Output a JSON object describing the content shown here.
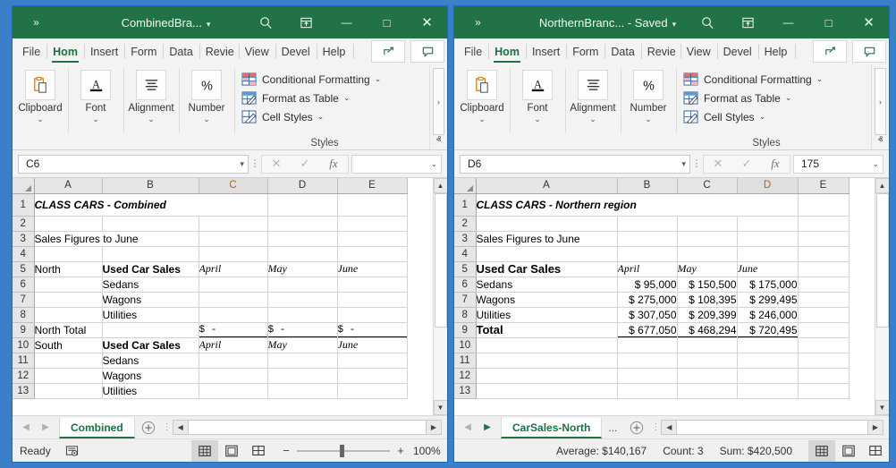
{
  "windows": [
    {
      "id": "left",
      "titlebar": {
        "qat_label": "»",
        "title": "CombinedBra...",
        "caret": "▾",
        "search_icon": "search-icon",
        "restore_icon": "ribbon-display-options-icon",
        "minimize_label": "—",
        "maximize_label": "□",
        "close_label": "✕"
      },
      "ribbon_tabs": {
        "items": [
          "File",
          "Hom",
          "Insert",
          "Form",
          "Data",
          "Revie",
          "View",
          "Devel",
          "Help"
        ],
        "active_index": 1,
        "share_icon": "share-icon",
        "comments_icon": "comment-icon"
      },
      "ribbon": {
        "groups": [
          {
            "label": "Clipboard",
            "icon": "clipboard-icon",
            "caret": "⌄"
          },
          {
            "label": "Font",
            "icon": "font-icon",
            "caret": "⌄"
          },
          {
            "label": "Alignment",
            "icon": "alignment-icon",
            "caret": "⌄"
          },
          {
            "label": "Number",
            "icon": "percent-icon",
            "caret": "⌄"
          }
        ],
        "styles": {
          "group_name": "Styles",
          "items": [
            {
              "label": "Conditional Formatting",
              "icon": "conditional-formatting-icon",
              "caret": "⌄"
            },
            {
              "label": "Format as Table",
              "icon": "format-as-table-icon",
              "caret": "⌄"
            },
            {
              "label": "Cell Styles",
              "icon": "cell-styles-icon",
              "caret": "⌄"
            }
          ]
        },
        "more_label": "›",
        "collapse_label": "ⱏ"
      },
      "formula_bar": {
        "name_box": "C6",
        "name_caret": "▾",
        "cancel_label": "✕",
        "enter_label": "✓",
        "fx_label": "fx",
        "formula_value": "",
        "expand_caret": "⌄"
      },
      "grid": {
        "columns": [
          "A",
          "B",
          "C",
          "D",
          "E"
        ],
        "selected_column": "C",
        "rows": [
          "1",
          "2",
          "3",
          "4",
          "5",
          "6",
          "7",
          "8",
          "9",
          "10",
          "11",
          "12",
          "13"
        ],
        "selected_row": "6",
        "cells": {
          "r1": {
            "A": "CLASS CARS - Combined",
            "B": "",
            "C": "",
            "D": "",
            "E": ""
          },
          "r2": {
            "A": "",
            "B": "",
            "C": "",
            "D": "",
            "E": ""
          },
          "r3": {
            "A": "Sales Figures to June",
            "B": "",
            "C": "",
            "D": "",
            "E": ""
          },
          "r4": {
            "A": "",
            "B": "",
            "C": "",
            "D": "",
            "E": ""
          },
          "r5": {
            "A": "North",
            "B": "Used Car Sales",
            "C": "April",
            "D": "May",
            "E": "June"
          },
          "r6": {
            "A": "",
            "B": "Sedans",
            "C": "",
            "D": "",
            "E": ""
          },
          "r7": {
            "A": "",
            "B": "Wagons",
            "C": "",
            "D": "",
            "E": ""
          },
          "r8": {
            "A": "",
            "B": "Utilities",
            "C": "",
            "D": "",
            "E": ""
          },
          "r9": {
            "A": "North Total",
            "B": "",
            "C": "$            -",
            "D": "$            -",
            "E": "$            -"
          },
          "r10": {
            "A": "South",
            "B": "Used Car Sales",
            "C": "April",
            "D": "May",
            "E": "June"
          },
          "r11": {
            "A": "",
            "B": "Sedans",
            "C": "",
            "D": "",
            "E": ""
          },
          "r12": {
            "A": "",
            "B": "Wagons",
            "C": "",
            "D": "",
            "E": ""
          },
          "r13": {
            "A": "",
            "B": "Utilities",
            "C": "",
            "D": "",
            "E": ""
          }
        }
      },
      "tabbar": {
        "prev_label": "◀",
        "next_label": "▶",
        "sheets": [
          "Combined"
        ],
        "ellipsis": "",
        "add_label": "+",
        "dots_label": "⋮",
        "hscroll_left": "◀",
        "hscroll_right": "▶"
      },
      "statusbar": {
        "mode": "Ready",
        "rec_icon": "macro-record-icon",
        "stats": [],
        "views": [
          {
            "name": "normal-view",
            "icon": "grid-icon",
            "active": true
          },
          {
            "name": "page-layout-view",
            "icon": "page-layout-icon",
            "active": false
          },
          {
            "name": "page-break-view",
            "icon": "page-break-icon",
            "active": false
          }
        ],
        "zoom_minus": "−",
        "zoom_plus": "+",
        "zoom_pct": "100%"
      }
    },
    {
      "id": "right",
      "titlebar": {
        "qat_label": "»",
        "title": "NorthernBranc...  -  Saved",
        "caret": "▾",
        "search_icon": "search-icon",
        "restore_icon": "ribbon-display-options-icon",
        "minimize_label": "—",
        "maximize_label": "□",
        "close_label": "✕"
      },
      "ribbon_tabs": {
        "items": [
          "File",
          "Hom",
          "Insert",
          "Form",
          "Data",
          "Revie",
          "View",
          "Devel",
          "Help"
        ],
        "active_index": 1,
        "share_icon": "share-icon",
        "comments_icon": "comment-icon"
      },
      "ribbon": {
        "groups": [
          {
            "label": "Clipboard",
            "icon": "clipboard-icon",
            "caret": "⌄"
          },
          {
            "label": "Font",
            "icon": "font-icon",
            "caret": "⌄"
          },
          {
            "label": "Alignment",
            "icon": "alignment-icon",
            "caret": "⌄"
          },
          {
            "label": "Number",
            "icon": "percent-icon",
            "caret": "⌄"
          }
        ],
        "styles": {
          "group_name": "Styles",
          "items": [
            {
              "label": "Conditional Formatting",
              "icon": "conditional-formatting-icon",
              "caret": "⌄"
            },
            {
              "label": "Format as Table",
              "icon": "format-as-table-icon",
              "caret": "⌄"
            },
            {
              "label": "Cell Styles",
              "icon": "cell-styles-icon",
              "caret": "⌄"
            }
          ]
        },
        "more_label": "›",
        "collapse_label": "ⱏ"
      },
      "formula_bar": {
        "name_box": "D6",
        "name_caret": "▾",
        "cancel_label": "✕",
        "enter_label": "✓",
        "fx_label": "fx",
        "formula_value": "175",
        "expand_caret": "⌄"
      },
      "grid": {
        "columns": [
          "A",
          "B",
          "C",
          "D",
          "E"
        ],
        "selected_column": "D",
        "rows": [
          "1",
          "2",
          "3",
          "4",
          "5",
          "6",
          "7",
          "8",
          "9",
          "10",
          "11",
          "12",
          "13"
        ],
        "selected_row": "6",
        "cells": {
          "r1": {
            "A": "CLASS CARS - Northern region",
            "B": "",
            "C": "",
            "D": "",
            "E": ""
          },
          "r2": {
            "A": "",
            "B": "",
            "C": "",
            "D": "",
            "E": ""
          },
          "r3": {
            "A": "Sales Figures to June",
            "B": "",
            "C": "",
            "D": "",
            "E": ""
          },
          "r4": {
            "A": "",
            "B": "",
            "C": "",
            "D": "",
            "E": ""
          },
          "r5": {
            "A": "Used Car Sales",
            "B": "April",
            "C": "May",
            "D": "June",
            "E": ""
          },
          "r6": {
            "A": "Sedans",
            "B": "$  95,000",
            "C": "$ 150,500",
            "D": "$ 175,000",
            "E": ""
          },
          "r7": {
            "A": "Wagons",
            "B": "$ 275,000",
            "C": "$ 108,395",
            "D": "$ 299,495",
            "E": ""
          },
          "r8": {
            "A": "Utilities",
            "B": "$ 307,050",
            "C": "$ 209,399",
            "D": "$ 246,000",
            "E": ""
          },
          "r9": {
            "A": "Total",
            "B": "$ 677,050",
            "C": "$ 468,294",
            "D": "$ 720,495",
            "E": ""
          },
          "r10": {
            "A": "",
            "B": "",
            "C": "",
            "D": "",
            "E": ""
          },
          "r11": {
            "A": "",
            "B": "",
            "C": "",
            "D": "",
            "E": ""
          },
          "r12": {
            "A": "",
            "B": "",
            "C": "",
            "D": "",
            "E": ""
          },
          "r13": {
            "A": "",
            "B": "",
            "C": "",
            "D": "",
            "E": ""
          }
        }
      },
      "tabbar": {
        "prev_label": "◀",
        "next_label": "▶",
        "sheets": [
          "CarSales-North"
        ],
        "ellipsis": "...",
        "add_label": "+",
        "dots_label": "⋮",
        "hscroll_left": "◀",
        "hscroll_right": "▶"
      },
      "statusbar": {
        "mode": "",
        "rec_icon": "",
        "stats": [
          "Average:  $140,167",
          "Count: 3",
          "Sum:  $420,500"
        ],
        "views": [
          {
            "name": "normal-view",
            "icon": "grid-icon",
            "active": true
          },
          {
            "name": "page-layout-view",
            "icon": "page-layout-icon",
            "active": false
          },
          {
            "name": "page-break-view",
            "icon": "page-break-icon",
            "active": false
          }
        ],
        "zoom_minus": "",
        "zoom_plus": "",
        "zoom_pct": ""
      }
    }
  ],
  "colors": {
    "excel_green": "#217346",
    "title_blue": "#1a12e0",
    "desktop_blue": "#3a7fc8",
    "selected_header": "#c06000"
  }
}
